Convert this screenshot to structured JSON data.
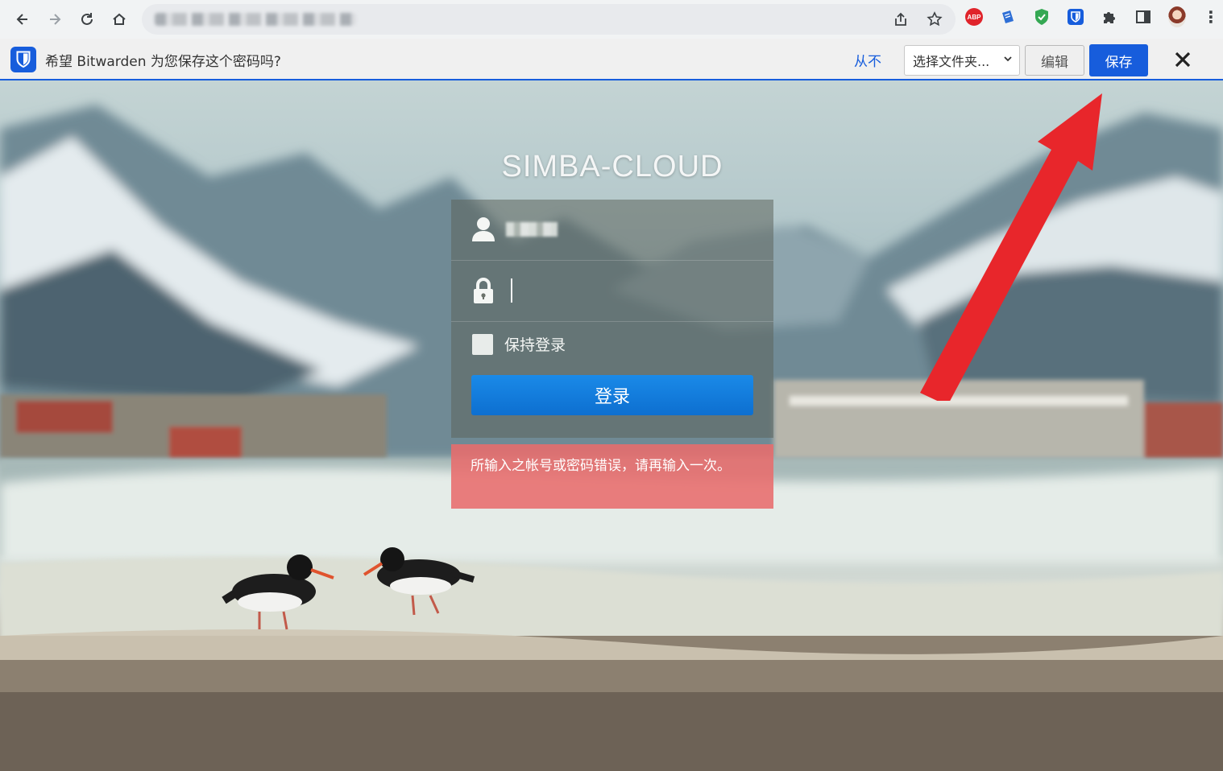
{
  "browser": {
    "nav": {
      "back": "back-arrow-icon",
      "forward": "forward-arrow-icon",
      "reload": "reload-icon",
      "home": "home-icon"
    },
    "omnibox_icons": [
      "share-icon",
      "bookmark-star-icon"
    ],
    "extensions": [
      {
        "name": "adblock-plus-icon",
        "label": "ABP",
        "color": "#e0242b"
      },
      {
        "name": "reader-extension-icon",
        "color": "#2e6fd6"
      },
      {
        "name": "shield-extension-icon",
        "color": "#34a853"
      },
      {
        "name": "bitwarden-extension-icon",
        "color": "#175ddc"
      },
      {
        "name": "puzzle-extensions-icon"
      },
      {
        "name": "side-panel-icon"
      }
    ]
  },
  "bitwarden_bar": {
    "message": "希望 Bitwarden 为您保存这个密码吗?",
    "never_label": "从不",
    "folder_select": "选择文件夹...",
    "edit_label": "编辑",
    "save_label": "保存",
    "accent": "#175ddc"
  },
  "login": {
    "site_title": "SIMBA-CLOUD",
    "remember_label": "保持登录",
    "login_button": "登录",
    "error_message": "所输入之帐号或密码错误，请再输入一次。",
    "button_color": "#0d7be0",
    "error_color": "#e86c6c"
  }
}
